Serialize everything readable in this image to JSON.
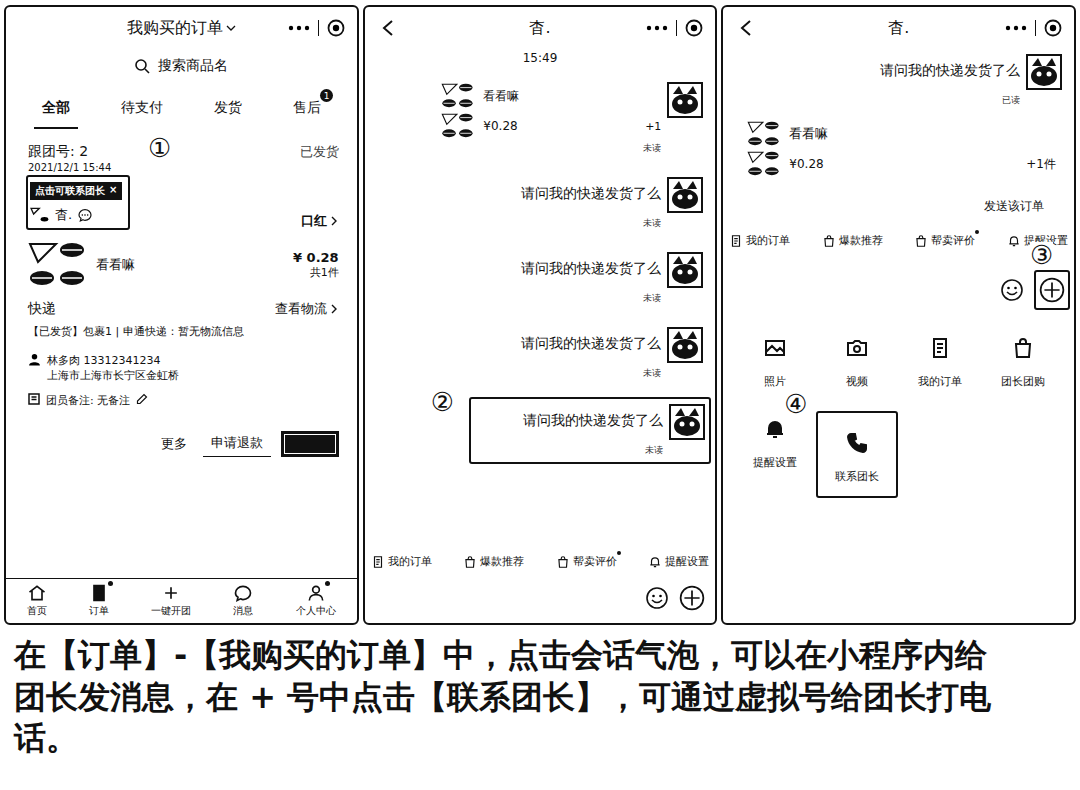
{
  "order_screen": {
    "title": "我购买的订单",
    "search_placeholder": "搜索商品名",
    "tabs": [
      {
        "label": "全部",
        "selected": true,
        "badge": ""
      },
      {
        "label": "待支付",
        "selected": false,
        "badge": ""
      },
      {
        "label": "发货",
        "selected": false,
        "badge": ""
      },
      {
        "label": "售后",
        "selected": false,
        "badge": "1"
      }
    ],
    "order": {
      "group_no": "跟团号: 2",
      "date": "2021/12/1 15:44",
      "status": "已发货",
      "tooltip": "点击可联系团长",
      "tooltip_close": "×",
      "leader": "杳.",
      "category": "口红",
      "product": "看看嘛",
      "price": "¥ 0.28",
      "quantity": "共1件",
      "delivery_label": "快递",
      "logistics_link": "查看物流",
      "package_info": "【已发货】包裹1 | 申通快递：暂无物流信息",
      "recipient_name": "林多肉",
      "recipient_phone": "13312341234",
      "address": "上海市上海市长宁区金虹桥",
      "note": "团员备注: 无备注",
      "buttons": [
        "更多",
        "申请退款"
      ]
    },
    "step": "①",
    "nav": [
      {
        "label": "首页",
        "dot": false,
        "selected": false
      },
      {
        "label": "订单",
        "dot": true,
        "selected": true
      },
      {
        "label": "一键开团",
        "dot": false,
        "selected": false
      },
      {
        "label": "消息",
        "dot": false,
        "selected": false
      },
      {
        "label": "个人中心",
        "dot": true,
        "selected": false
      }
    ]
  },
  "chat_screen": {
    "title": "杳.",
    "time": "15:49",
    "order_card": {
      "product": "看看嘛",
      "price": "¥0.28",
      "count": "+1",
      "status": "未读"
    },
    "messages": [
      {
        "text": "请问我的快递发货了么",
        "status": "未读",
        "highlighted": false
      },
      {
        "text": "请问我的快递发货了么",
        "status": "未读",
        "highlighted": false
      },
      {
        "text": "请问我的快递发货了么",
        "status": "未读",
        "highlighted": false
      },
      {
        "text": "请问我的快递发货了么",
        "status": "未读",
        "highlighted": true
      }
    ],
    "step": "②",
    "toolbar": [
      {
        "label": "我的订单",
        "dot": false
      },
      {
        "label": "爆款推荐",
        "dot": false
      },
      {
        "label": "帮卖评价",
        "dot": true
      },
      {
        "label": "提醒设置",
        "dot": false
      }
    ]
  },
  "menu_screen": {
    "title": "杳.",
    "message": {
      "text": "请问我的快递发货了么",
      "status": "已读"
    },
    "order_card": {
      "product": "看看嘛",
      "price": "¥0.28",
      "count": "+1件",
      "action": "发送该订单"
    },
    "toolbar": [
      {
        "label": "我的订单",
        "dot": false
      },
      {
        "label": "爆款推荐",
        "dot": false
      },
      {
        "label": "帮卖评价",
        "dot": true
      },
      {
        "label": "提醒设置",
        "dot": false
      }
    ],
    "plus_step": "③",
    "actions": [
      {
        "label": "照片",
        "highlighted": false
      },
      {
        "label": "视频",
        "highlighted": false
      },
      {
        "label": "我的订单",
        "highlighted": false
      },
      {
        "label": "团长团购",
        "highlighted": false
      },
      {
        "label": "提醒设置",
        "highlighted": false
      },
      {
        "label": "联系团长",
        "highlighted": true
      }
    ],
    "action_step": "④"
  },
  "caption": "在【订单】-【我购买的订单】中，点击会话气泡，可以在小程序内给团长发消息，在 + 号中点击【联系团长】，可通过虚拟号给团长打电话。"
}
